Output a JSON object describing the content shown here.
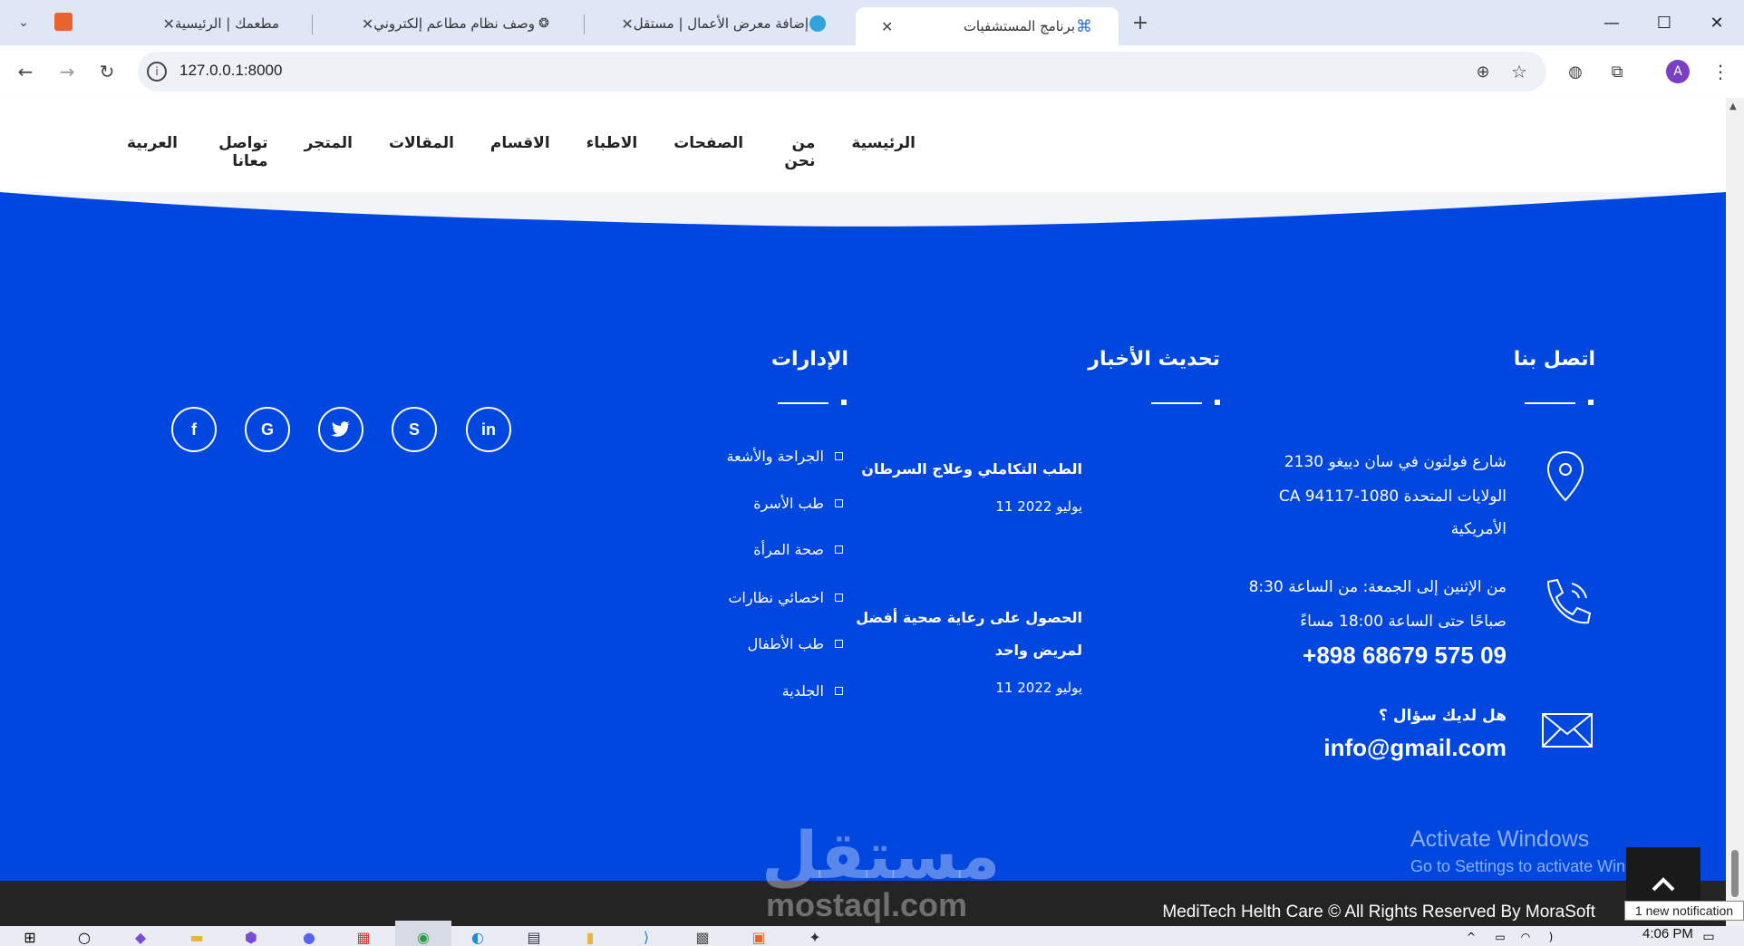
{
  "browser": {
    "tabs": [
      {
        "title": "برنامج المستشفيات",
        "active": true
      },
      {
        "title": "إضافة معرض الأعمال | مستقل",
        "active": false
      },
      {
        "title": "وصف نظام مطاعم إلكتروني",
        "active": false
      },
      {
        "title": "مطعمك | الرئيسية",
        "active": false
      }
    ],
    "new_tab": "+",
    "url": "127.0.0.1:8000",
    "profile_initial": "A"
  },
  "nav": {
    "items": [
      "الرئيسية",
      "من نحن",
      "الصفحات",
      "الاطباء",
      "الاقسام",
      "المقالات",
      "المتجر",
      "تواصل معانا",
      "العربية"
    ]
  },
  "footer": {
    "contact": {
      "title": "اتصل بنا",
      "address_line1": "شارع فولتون في سان دييغو 2130",
      "address_line2": "الولايات المتحدة CA 94117-1080",
      "address_line3": "الأمريكية",
      "hours_line1": "من الإثنين إلى الجمعة: من الساعة 8:30",
      "hours_line2": "صباحًا حتى الساعة 18:00 مساءً",
      "phone": "+898 68679 575 09",
      "question": "هل لديك سؤال ؟",
      "email": "info@gmail.com"
    },
    "news": {
      "title": "تحديث الأخبار",
      "items": [
        {
          "title": "الطب التكاملي وعلاج السرطان",
          "date": "يوليو 2022 11"
        },
        {
          "title_line1": "الحصول على رعاية صحية أفضل",
          "title_line2": "لمريض واحد",
          "date": "يوليو 2022 11"
        }
      ]
    },
    "departments": {
      "title": "الإدارات",
      "items": [
        "الجراحة والأشعة",
        "طب الأسرة",
        "صحة المرأة",
        "اخصائي نظارات",
        "طب الأطفال",
        "الجلدية"
      ]
    },
    "social": [
      "linkedin-icon",
      "skype-icon",
      "twitter-icon",
      "google-icon",
      "facebook-icon"
    ]
  },
  "copyright": "MediTech Helth Care © All Rights Reserved By MoraSoft",
  "overlays": {
    "activate_title": "Activate Windows",
    "activate_sub": "Go to Settings to activate Windows.",
    "watermark_ar": "مستقل",
    "watermark_en": "mostaql.com",
    "notification": "1 new notification",
    "clock": "4:06 PM"
  },
  "colors": {
    "footer_bg": "#0047e0",
    "copybar_bg": "#242424",
    "tabstrip_bg": "#dfe7f7"
  }
}
